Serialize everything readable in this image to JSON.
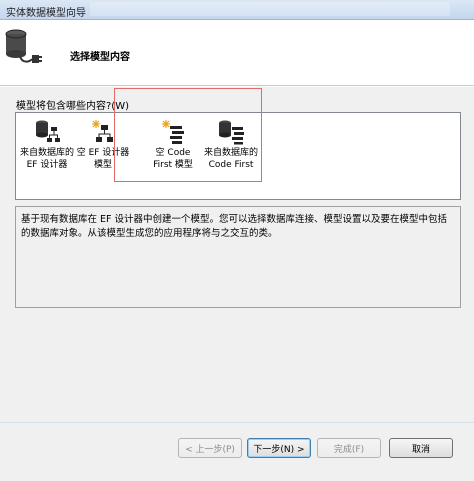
{
  "window": {
    "title": "实体数据模型向导"
  },
  "header": {
    "heading": "选择模型内容"
  },
  "content": {
    "question_label": "模型将包含哪些内容?(W)",
    "items": [
      {
        "label": "来自数据库的\nEF 设计器",
        "icon": "database-diagram-icon"
      },
      {
        "label": "空 EF 设计器\n模型",
        "icon": "empty-diagram-icon"
      },
      {
        "label": "空 Code\nFirst 模型",
        "icon": "empty-code-icon"
      },
      {
        "label": "来自数据库的\nCode First",
        "icon": "database-code-icon"
      }
    ],
    "description": "基于现有数据库在 EF 设计器中创建一个模型。您可以选择数据库连接、模型设置以及要在模型中包括的数据库对象。从该模型生成您的应用程序将与之交互的类。"
  },
  "buttons": {
    "back": "< 上一步(P)",
    "next": "下一步(N) >",
    "finish": "完成(F)",
    "cancel": "取消"
  }
}
